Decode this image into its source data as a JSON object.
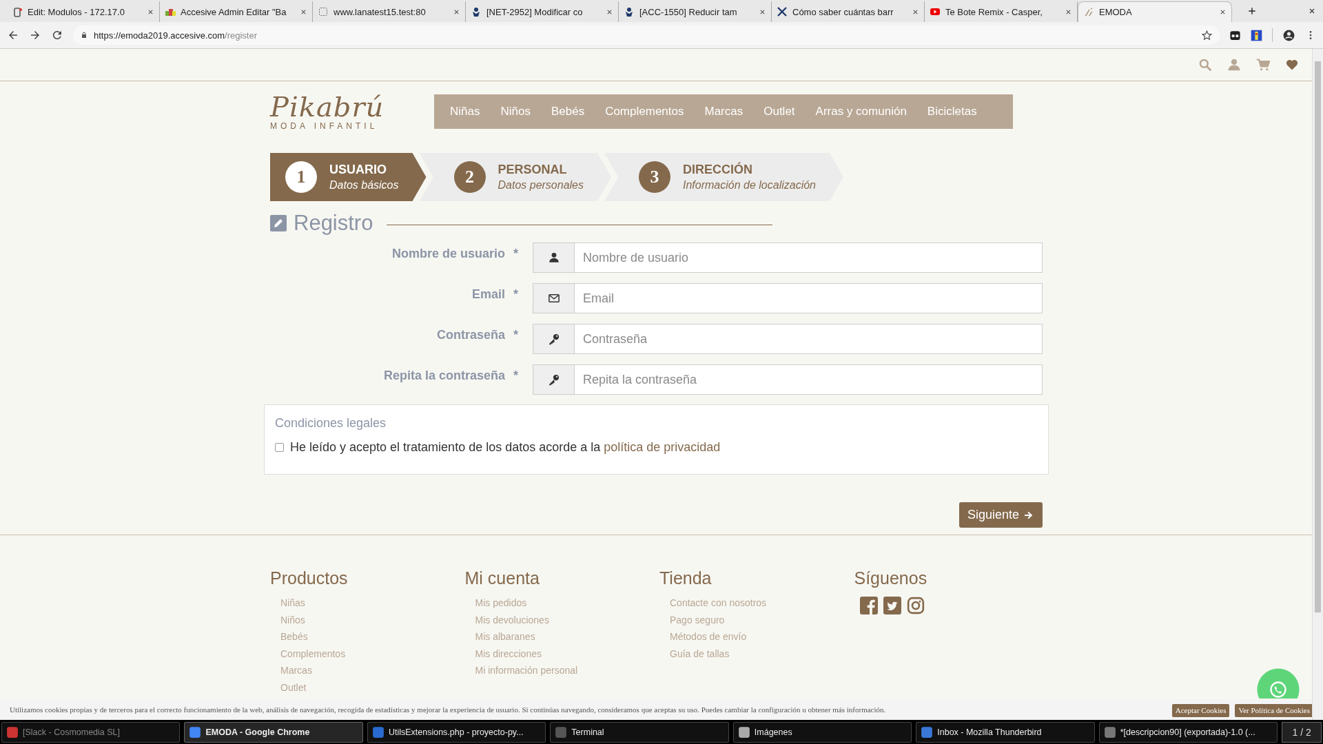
{
  "browser": {
    "tabs": [
      {
        "title": "Edit: Modulos - 172.17.0",
        "selected": false
      },
      {
        "title": "Accesive Admin Editar \"Ba",
        "selected": false
      },
      {
        "title": "www.lanatest15.test:80",
        "selected": false
      },
      {
        "title": "[NET-2952] Modificar co",
        "selected": false
      },
      {
        "title": "[ACC-1550] Reducir tam",
        "selected": false
      },
      {
        "title": "Cómo saber cuántas barr",
        "selected": false
      },
      {
        "title": "Te Bote Remix - Casper,",
        "selected": false
      },
      {
        "title": "EMODA",
        "selected": true
      }
    ],
    "address": {
      "host": "https://emoda2019.accesive.com",
      "path": "/register"
    }
  },
  "site": {
    "logo": {
      "name": "Pikabrú",
      "tagline": "MODA INFANTIL"
    },
    "nav": [
      "Niñas",
      "Niños",
      "Bebés",
      "Complementos",
      "Marcas",
      "Outlet",
      "Arras y comunión",
      "Bicicletas"
    ],
    "steps": [
      {
        "number": "1",
        "title": "USUARIO",
        "subtitle": "Datos básicos",
        "selected": true
      },
      {
        "number": "2",
        "title": "PERSONAL",
        "subtitle": "Datos personales",
        "selected": false
      },
      {
        "number": "3",
        "title": "DIRECCIÓN",
        "subtitle": "Información de localización",
        "selected": false
      }
    ],
    "form": {
      "heading": "Registro",
      "fields": [
        {
          "label": "Nombre de usuario",
          "required_mark": "*",
          "kind": "user",
          "placeholder": "Nombre de usuario"
        },
        {
          "label": "Email",
          "required_mark": "*",
          "kind": "email",
          "placeholder": "Email"
        },
        {
          "label": "Contraseña",
          "required_mark": "*",
          "kind": "password",
          "placeholder": "Contraseña"
        },
        {
          "label": "Repita la contraseña",
          "required_mark": "*",
          "kind": "password",
          "placeholder": "Repita la contraseña"
        }
      ],
      "legal": {
        "title": "Condiciones legales",
        "checked": false,
        "text": "He leído y acepto el tratamiento de los datos acorde a la",
        "link": "política de privacidad"
      },
      "submit": "Siguiente"
    },
    "footer": {
      "columns": [
        {
          "title": "Productos",
          "links": [
            "Niñas",
            "Niños",
            "Bebés",
            "Complementos",
            "Marcas",
            "Outlet"
          ]
        },
        {
          "title": "Mi cuenta",
          "links": [
            "Mis pedidos",
            "Mis devoluciones",
            "Mis albaranes",
            "Mis direcciones",
            "Mi información personal"
          ]
        },
        {
          "title": "Tienda",
          "links": [
            "Contacte con nosotros",
            "Pago seguro",
            "Métodos de envío",
            "Guía de tallas"
          ]
        }
      ],
      "social": {
        "title": "Síguenos"
      }
    },
    "cookies": {
      "text": "Utilizamos cookies propias y de terceros para el correcto funcionamiento de la web, análisis de navegación, recogida de estadísticas y mejorar la experiencia de usuario. Si continúas navegando, consideramos que aceptas su uso. Puedes cambiar la configuración u obtener más información.",
      "buttons": [
        "Aceptar Cookies",
        "Ver Política de Cookies"
      ]
    }
  },
  "taskbar": {
    "items": [
      {
        "label": "[Slack - Cosmomedia SL]",
        "selected": false,
        "minimized": true
      },
      {
        "label": "EMODA - Google Chrome",
        "selected": true,
        "minimized": false
      },
      {
        "label": "UtilsExtensions.php - proyecto-py...",
        "selected": false,
        "minimized": false
      },
      {
        "label": "Terminal",
        "selected": false,
        "minimized": false
      },
      {
        "label": "Imágenes",
        "selected": false,
        "minimized": false
      },
      {
        "label": "Inbox - Mozilla Thunderbird",
        "selected": false,
        "minimized": false
      },
      {
        "label": "*[descripcion90] (exportada)-1.0 (...",
        "selected": false,
        "minimized": false
      }
    ],
    "workspace": "1 / 2"
  }
}
